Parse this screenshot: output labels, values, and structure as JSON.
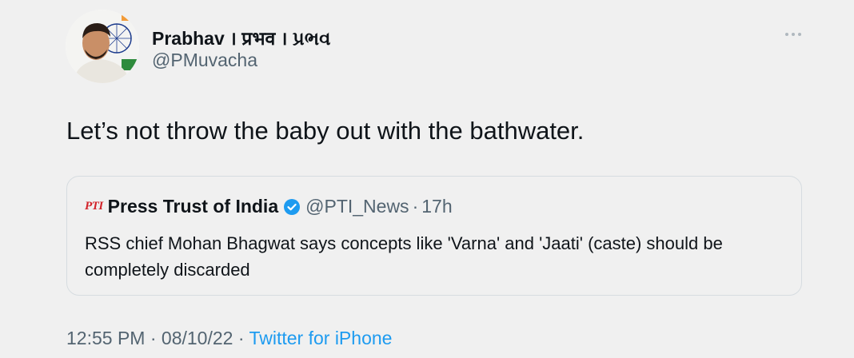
{
  "author": {
    "name": "Prabhav । प्रभव । પ્રભવ",
    "handle": "@PMuvacha"
  },
  "tweet": {
    "text": "Let’s not throw the baby out with the bathwater."
  },
  "quote": {
    "logo_text": "PTI",
    "name": "Press Trust of India",
    "handle": "@PTI_News",
    "separator": "·",
    "time": "17h",
    "text": "RSS chief Mohan Bhagwat says concepts like 'Varna' and 'Jaati' (caste) should be completely discarded"
  },
  "meta": {
    "time": "12:55 PM",
    "separator1": " · ",
    "date": "08/10/22",
    "separator2": " · ",
    "source": "Twitter for iPhone"
  },
  "colors": {
    "accent": "#1d9bf0",
    "secondary_text": "#536471",
    "logo_red": "#d2232a"
  }
}
